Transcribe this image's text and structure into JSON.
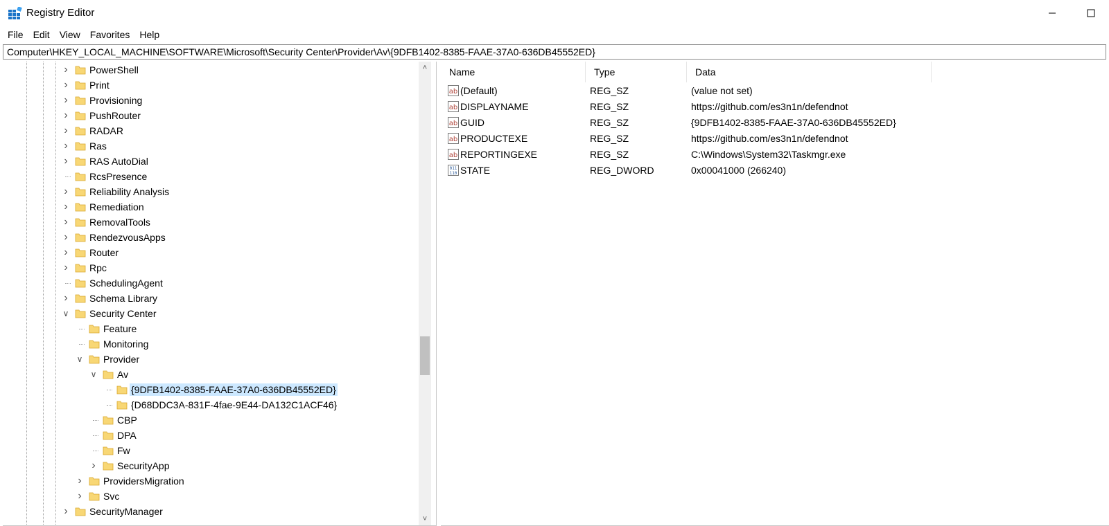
{
  "window": {
    "title": "Registry Editor",
    "icon": "registry-editor-icon",
    "controls": [
      "minimize-icon",
      "maximize-icon"
    ]
  },
  "menu": [
    "File",
    "Edit",
    "View",
    "Favorites",
    "Help"
  ],
  "address": "Computer\\HKEY_LOCAL_MACHINE\\SOFTWARE\\Microsoft\\Security Center\\Provider\\Av\\{9DFB1402-8385-FAAE-37A0-636DB45552ED}",
  "tree": {
    "items": [
      {
        "label": "PowerShell",
        "depth": 0,
        "expander": "collapsed"
      },
      {
        "label": "Print",
        "depth": 0,
        "expander": "collapsed"
      },
      {
        "label": "Provisioning",
        "depth": 0,
        "expander": "collapsed"
      },
      {
        "label": "PushRouter",
        "depth": 0,
        "expander": "collapsed"
      },
      {
        "label": "RADAR",
        "depth": 0,
        "expander": "collapsed"
      },
      {
        "label": "Ras",
        "depth": 0,
        "expander": "collapsed"
      },
      {
        "label": "RAS AutoDial",
        "depth": 0,
        "expander": "collapsed"
      },
      {
        "label": "RcsPresence",
        "depth": 0,
        "expander": "none"
      },
      {
        "label": "Reliability Analysis",
        "depth": 0,
        "expander": "collapsed"
      },
      {
        "label": "Remediation",
        "depth": 0,
        "expander": "collapsed"
      },
      {
        "label": "RemovalTools",
        "depth": 0,
        "expander": "collapsed"
      },
      {
        "label": "RendezvousApps",
        "depth": 0,
        "expander": "collapsed"
      },
      {
        "label": "Router",
        "depth": 0,
        "expander": "collapsed"
      },
      {
        "label": "Rpc",
        "depth": 0,
        "expander": "collapsed"
      },
      {
        "label": "SchedulingAgent",
        "depth": 0,
        "expander": "none"
      },
      {
        "label": "Schema Library",
        "depth": 0,
        "expander": "collapsed"
      },
      {
        "label": "Security Center",
        "depth": 0,
        "expander": "expanded"
      },
      {
        "label": "Feature",
        "depth": 1,
        "expander": "none"
      },
      {
        "label": "Monitoring",
        "depth": 1,
        "expander": "none"
      },
      {
        "label": "Provider",
        "depth": 1,
        "expander": "expanded"
      },
      {
        "label": "Av",
        "depth": 2,
        "expander": "expanded"
      },
      {
        "label": "{9DFB1402-8385-FAAE-37A0-636DB45552ED}",
        "depth": 3,
        "expander": "none",
        "selected": true
      },
      {
        "label": "{D68DDC3A-831F-4fae-9E44-DA132C1ACF46}",
        "depth": 3,
        "expander": "none"
      },
      {
        "label": "CBP",
        "depth": 2,
        "expander": "none"
      },
      {
        "label": "DPA",
        "depth": 2,
        "expander": "none"
      },
      {
        "label": "Fw",
        "depth": 2,
        "expander": "none"
      },
      {
        "label": "SecurityApp",
        "depth": 2,
        "expander": "collapsed"
      },
      {
        "label": "ProvidersMigration",
        "depth": 1,
        "expander": "collapsed"
      },
      {
        "label": "Svc",
        "depth": 1,
        "expander": "collapsed"
      },
      {
        "label": "SecurityManager",
        "depth": 0,
        "expander": "collapsed"
      }
    ]
  },
  "values": {
    "columns": [
      "Name",
      "Type",
      "Data"
    ],
    "rows": [
      {
        "name": "(Default)",
        "type": "REG_SZ",
        "data": "(value not set)",
        "icon": "string-value-icon"
      },
      {
        "name": "DISPLAYNAME",
        "type": "REG_SZ",
        "data": "https://github.com/es3n1n/defendnot",
        "icon": "string-value-icon"
      },
      {
        "name": "GUID",
        "type": "REG_SZ",
        "data": "{9DFB1402-8385-FAAE-37A0-636DB45552ED}",
        "icon": "string-value-icon"
      },
      {
        "name": "PRODUCTEXE",
        "type": "REG_SZ",
        "data": "https://github.com/es3n1n/defendnot",
        "icon": "string-value-icon"
      },
      {
        "name": "REPORTINGEXE",
        "type": "REG_SZ",
        "data": "C:\\Windows\\System32\\Taskmgr.exe",
        "icon": "string-value-icon"
      },
      {
        "name": "STATE",
        "type": "REG_DWORD",
        "data": "0x00041000 (266240)",
        "icon": "binary-value-icon"
      }
    ]
  },
  "colors": {
    "selection": "#cce8ff",
    "folder": "#f8d775",
    "string_icon": "#b0463c",
    "binary_icon": "#2a5a9a"
  }
}
